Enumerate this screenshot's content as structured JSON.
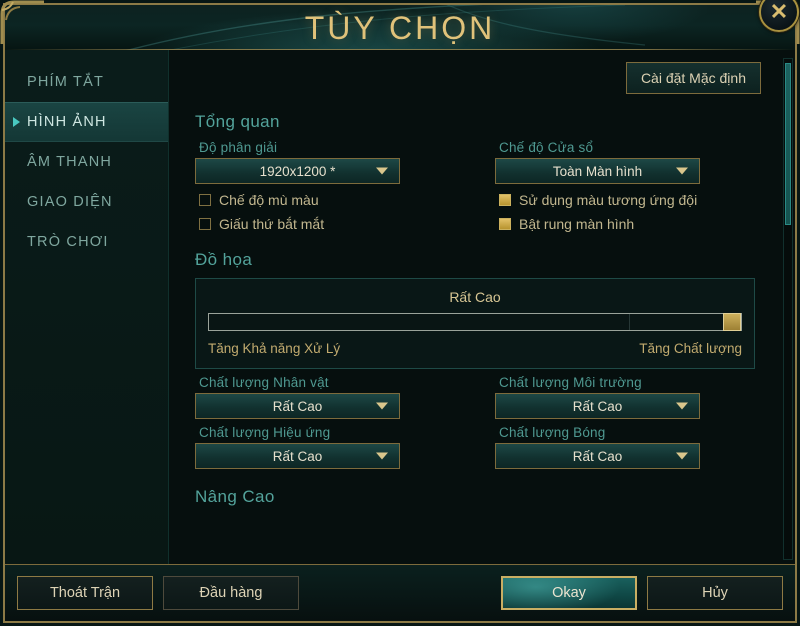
{
  "window": {
    "title": "TÙY CHỌN",
    "close_icon": "close-icon",
    "close_glyph": "✕"
  },
  "sidebar": {
    "items": [
      {
        "label": "PHÍM TẮT",
        "active": false
      },
      {
        "label": "HÌNH ẢNH",
        "active": true
      },
      {
        "label": "ÂM THANH",
        "active": false
      },
      {
        "label": "GIAO DIỆN",
        "active": false
      },
      {
        "label": "TRÒ CHƠI",
        "active": false
      }
    ]
  },
  "content": {
    "defaults_button": "Cài đặt Mặc định",
    "sections": {
      "overview": {
        "title": "Tổng quan",
        "resolution": {
          "label": "Độ phân giải",
          "value": "1920x1200 *"
        },
        "window_mode": {
          "label": "Chế độ Cửa sổ",
          "value": "Toàn Màn hình"
        },
        "checkboxes": [
          {
            "label": "Chế độ mù màu",
            "checked": false
          },
          {
            "label": "Giấu thứ bắt mắt",
            "checked": false
          },
          {
            "label": "Sử dụng màu tương ứng đội",
            "checked": true
          },
          {
            "label": "Bật rung màn hình",
            "checked": true
          }
        ]
      },
      "graphics": {
        "title": "Đồ họa",
        "slider": {
          "value_label": "Rất Cao",
          "left_end": "Tăng Khả năng Xử Lý",
          "right_end": "Tăng Chất lượng",
          "percent": 100
        },
        "dropdowns": [
          {
            "label": "Chất lượng Nhân vật",
            "value": "Rất Cao"
          },
          {
            "label": "Chất lượng Môi trường",
            "value": "Rất Cao"
          },
          {
            "label": "Chất lượng Hiệu ứng",
            "value": "Rất Cao"
          },
          {
            "label": "Chất lượng Bóng",
            "value": "Rất Cao"
          }
        ]
      },
      "advanced": {
        "title": "Nâng Cao"
      }
    },
    "dropdown_arrow_icon": "chevron-down-icon"
  },
  "footer": {
    "exit_match": "Thoát Trận",
    "surrender": "Đầu hàng",
    "okay": "Okay",
    "cancel": "Hủy"
  },
  "colors": {
    "gold": "#c9ae63",
    "teal_accent": "#49c8c0",
    "title_gold": "#e0c27a",
    "section_teal": "#53a39b",
    "checkbox_on": "#d8b758"
  }
}
